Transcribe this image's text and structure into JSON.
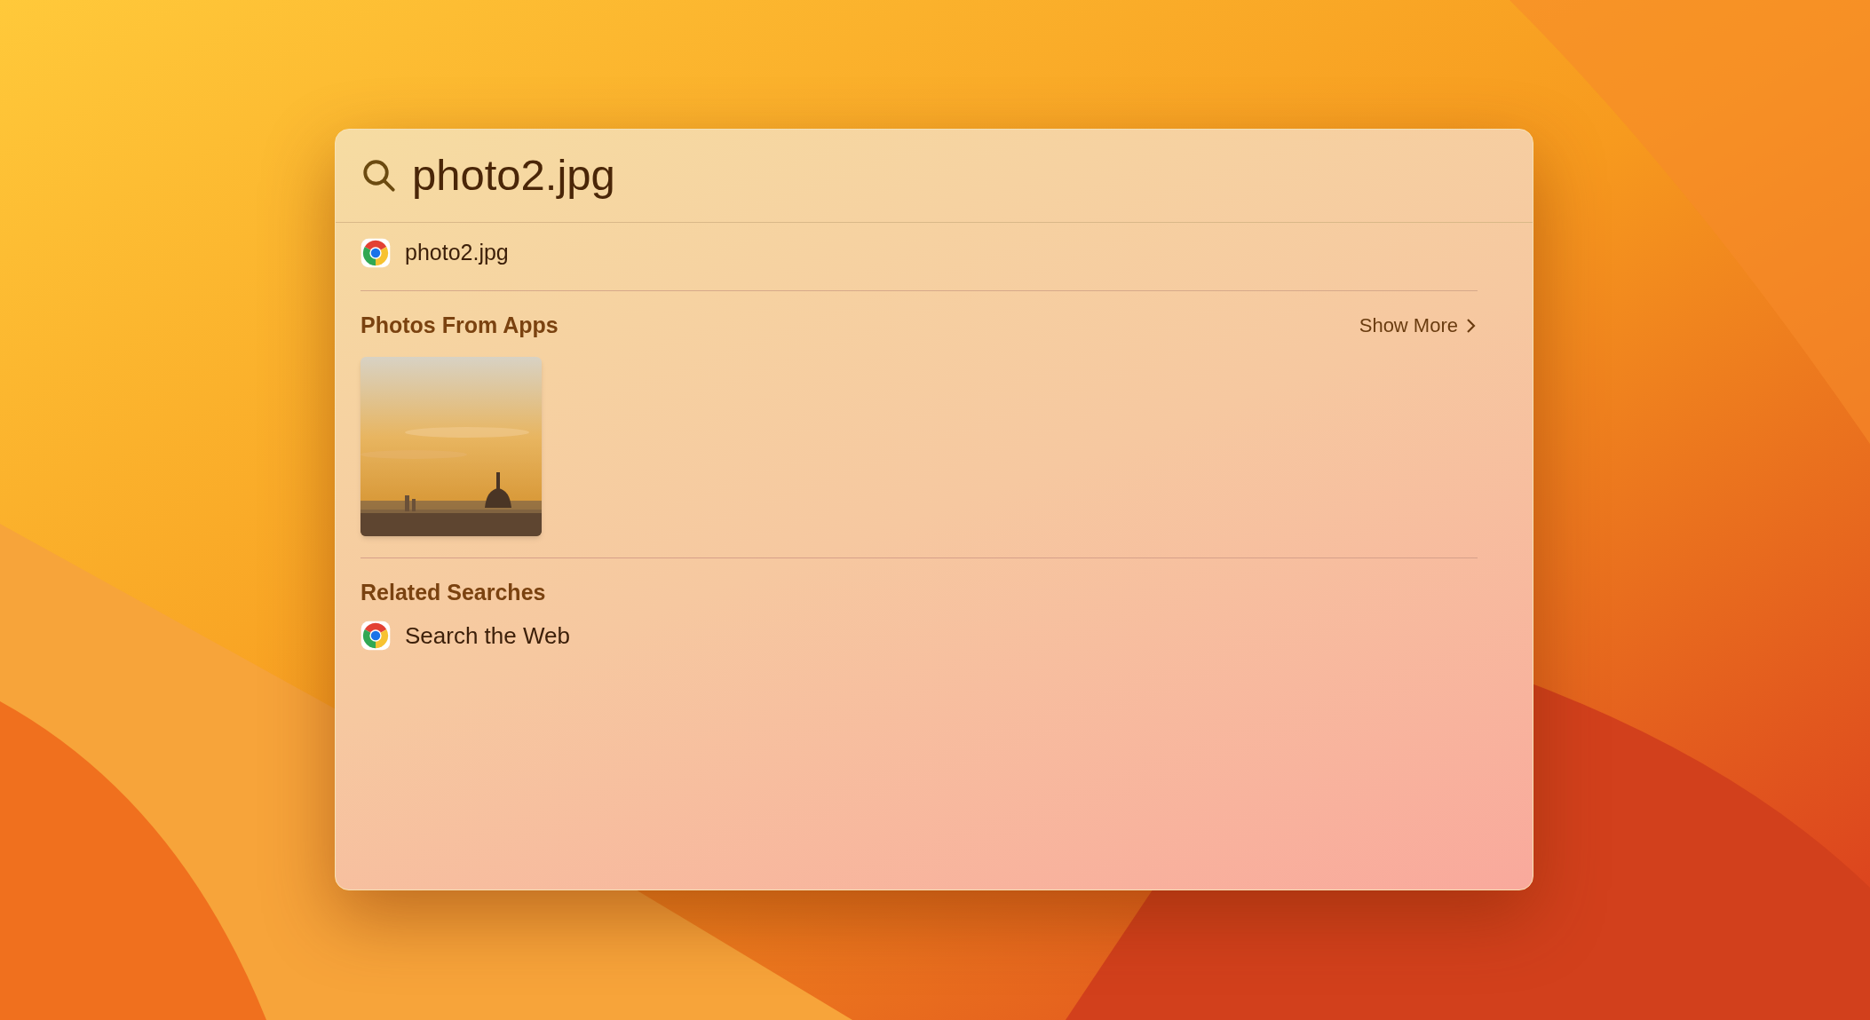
{
  "search": {
    "value": "photo2.jpg"
  },
  "top_hit": {
    "label": "photo2.jpg"
  },
  "photos_section": {
    "title": "Photos From Apps",
    "show_more": "Show More"
  },
  "related_section": {
    "title": "Related Searches",
    "items": [
      {
        "label": "Search the Web"
      }
    ]
  }
}
